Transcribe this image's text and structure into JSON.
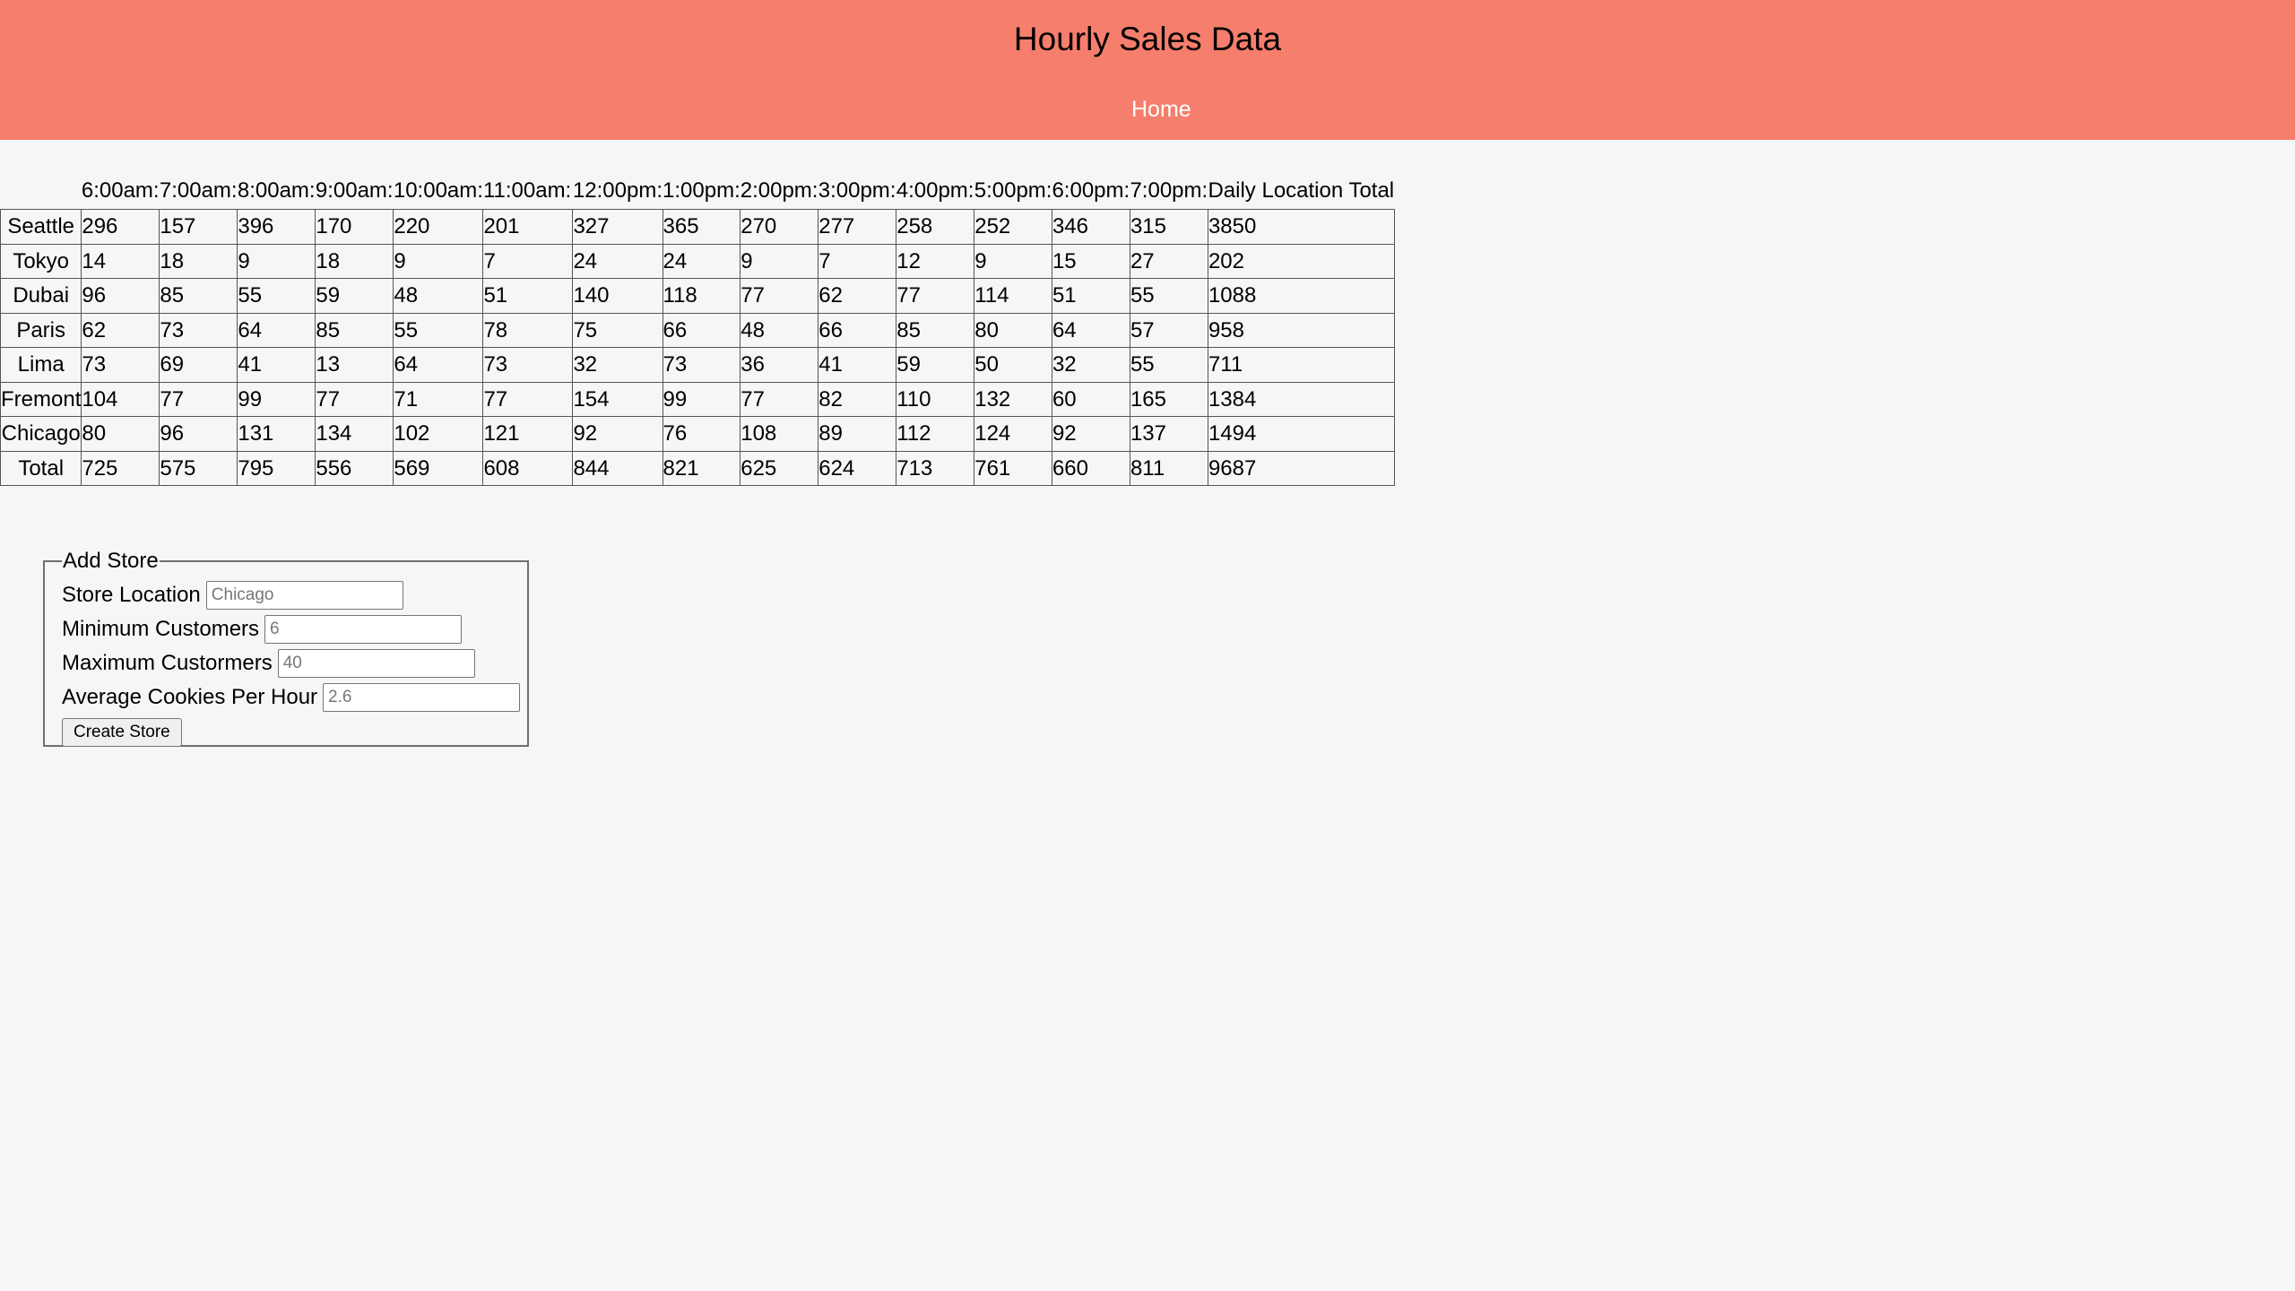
{
  "header": {
    "title": "Hourly Sales Data",
    "nav": {
      "home_label": "Home"
    }
  },
  "sales_table": {
    "columns": [
      "6:00am:",
      "7:00am:",
      "8:00am:",
      "9:00am:",
      "10:00am:",
      "11:00am:",
      "12:00pm:",
      "1:00pm:",
      "2:00pm:",
      "3:00pm:",
      "4:00pm:",
      "5:00pm:",
      "6:00pm:",
      "7:00pm:",
      "Daily Location Total"
    ],
    "rows": [
      {
        "location": "Seattle",
        "values": [
          "296",
          "157",
          "396",
          "170",
          "220",
          "201",
          "327",
          "365",
          "270",
          "277",
          "258",
          "252",
          "346",
          "315",
          "3850"
        ]
      },
      {
        "location": "Tokyo",
        "values": [
          "14",
          "18",
          "9",
          "18",
          "9",
          "7",
          "24",
          "24",
          "9",
          "7",
          "12",
          "9",
          "15",
          "27",
          "202"
        ]
      },
      {
        "location": "Dubai",
        "values": [
          "96",
          "85",
          "55",
          "59",
          "48",
          "51",
          "140",
          "118",
          "77",
          "62",
          "77",
          "114",
          "51",
          "55",
          "1088"
        ]
      },
      {
        "location": "Paris",
        "values": [
          "62",
          "73",
          "64",
          "85",
          "55",
          "78",
          "75",
          "66",
          "48",
          "66",
          "85",
          "80",
          "64",
          "57",
          "958"
        ]
      },
      {
        "location": "Lima",
        "values": [
          "73",
          "69",
          "41",
          "13",
          "64",
          "73",
          "32",
          "73",
          "36",
          "41",
          "59",
          "50",
          "32",
          "55",
          "711"
        ]
      },
      {
        "location": "Fremont",
        "values": [
          "104",
          "77",
          "99",
          "77",
          "71",
          "77",
          "154",
          "99",
          "77",
          "82",
          "110",
          "132",
          "60",
          "165",
          "1384"
        ]
      },
      {
        "location": "Chicago",
        "values": [
          "80",
          "96",
          "131",
          "134",
          "102",
          "121",
          "92",
          "76",
          "108",
          "89",
          "112",
          "124",
          "92",
          "137",
          "1494"
        ]
      },
      {
        "location": "Total",
        "values": [
          "725",
          "575",
          "795",
          "556",
          "569",
          "608",
          "844",
          "821",
          "625",
          "624",
          "713",
          "761",
          "660",
          "811",
          "9687"
        ]
      }
    ]
  },
  "add_store_form": {
    "legend": "Add Store",
    "fields": [
      {
        "label": "Store Location",
        "placeholder": "Chicago"
      },
      {
        "label": "Minimum Customers",
        "placeholder": "6"
      },
      {
        "label": "Maximum Custormers",
        "placeholder": "40"
      },
      {
        "label": "Average Cookies Per Hour",
        "placeholder": "2.6"
      }
    ],
    "submit_label": "Create Store"
  },
  "colors": {
    "header_background": "#f67e6c",
    "page_background": "#f6f6f6",
    "nav_text": "#ffffff"
  }
}
